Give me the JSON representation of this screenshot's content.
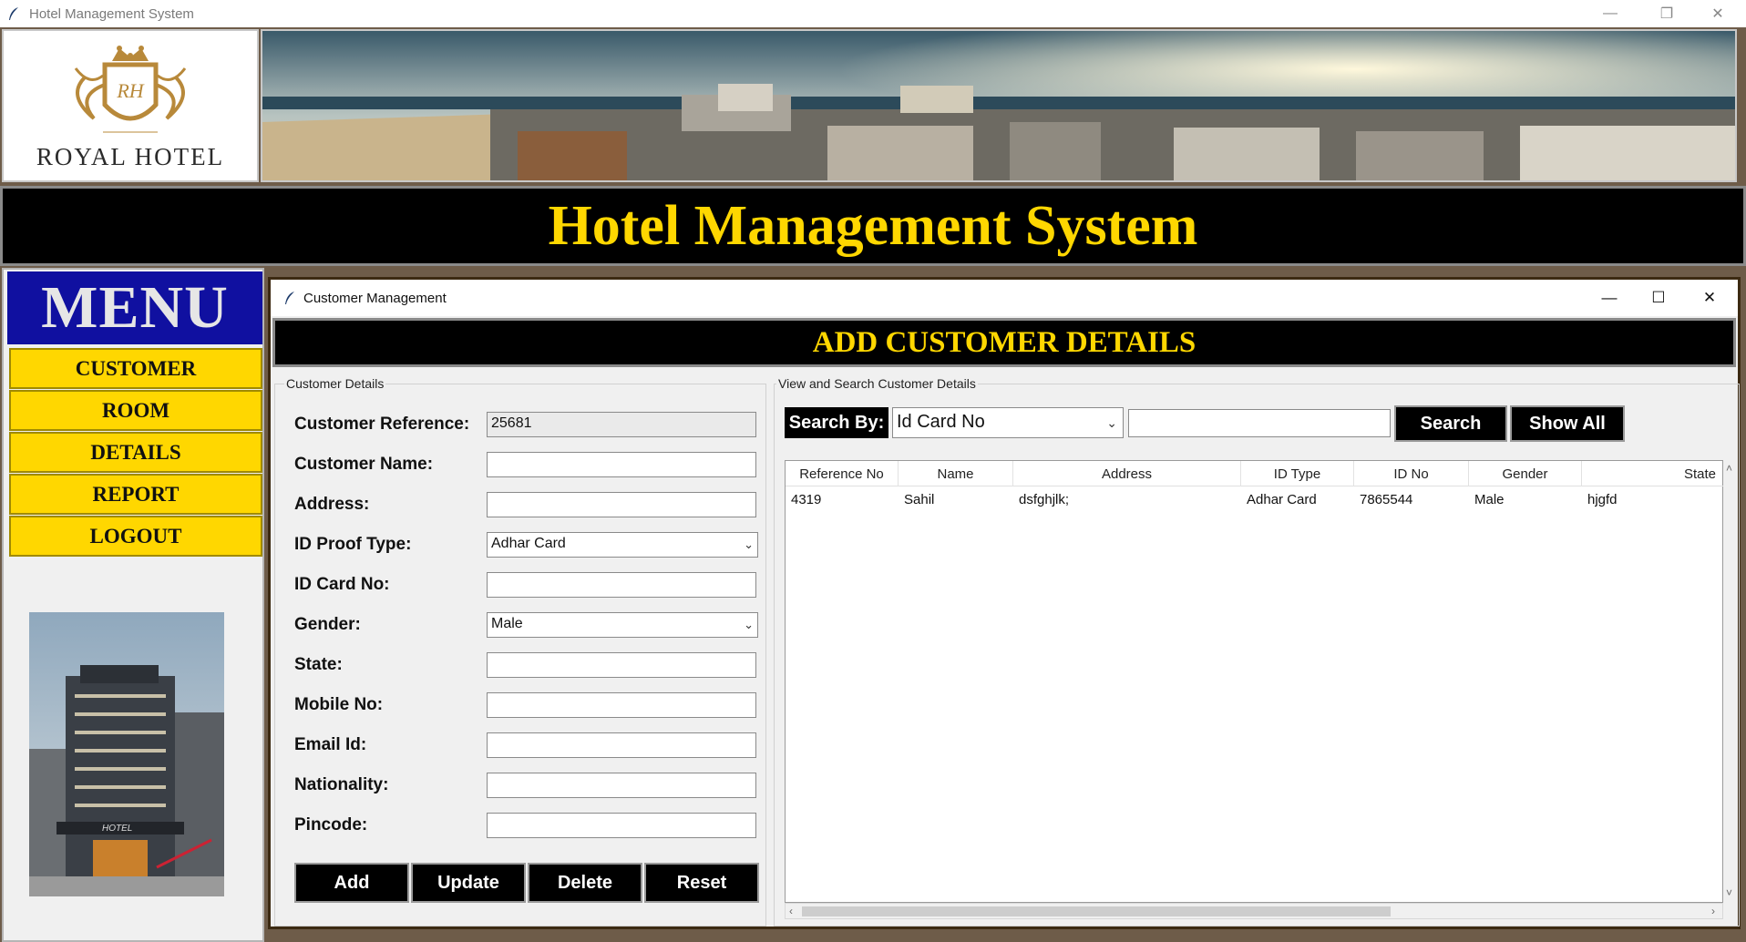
{
  "window": {
    "title": "Hotel Management System",
    "controls": [
      "—",
      "❐",
      "✕"
    ]
  },
  "header": {
    "logo_text": "ROYAL HOTEL",
    "logo_monogram": "RH",
    "banner_title": "Hotel Management System"
  },
  "menu": {
    "title": "MENU",
    "items": [
      {
        "label": "CUSTOMER"
      },
      {
        "label": "ROOM"
      },
      {
        "label": "DETAILS"
      },
      {
        "label": "REPORT"
      },
      {
        "label": "LOGOUT"
      }
    ],
    "image_sign": "HOTEL"
  },
  "child_window": {
    "title": "Customer Management",
    "controls": [
      "—",
      "☐",
      "✕"
    ],
    "heading": "ADD CUSTOMER DETAILS"
  },
  "customer_details": {
    "group_label": "Customer Details",
    "fields": [
      {
        "label": "Customer Reference:",
        "value": "25681"
      },
      {
        "label": "Customer Name:",
        "value": ""
      },
      {
        "label": "Address:",
        "value": ""
      },
      {
        "label": "ID Proof Type:",
        "value": "Adhar Card"
      },
      {
        "label": "ID Card No:",
        "value": ""
      },
      {
        "label": "Gender:",
        "value": "Male"
      },
      {
        "label": "State:",
        "value": ""
      },
      {
        "label": "Mobile No:",
        "value": ""
      },
      {
        "label": "Email Id:",
        "value": ""
      },
      {
        "label": "Nationality:",
        "value": ""
      },
      {
        "label": "Pincode:",
        "value": ""
      }
    ],
    "buttons": {
      "add": "Add",
      "update": "Update",
      "delete": "Delete",
      "reset": "Reset"
    }
  },
  "search_panel": {
    "group_label": "View and Search Customer Details",
    "search_by_label": "Search By:",
    "search_by_value": "Id Card No",
    "search_text": "",
    "search_button": "Search",
    "show_all_button": "Show All",
    "columns": [
      "Reference No",
      "Name",
      "Address",
      "ID Type",
      "ID No",
      "Gender",
      "State"
    ],
    "rows": [
      [
        "4319",
        "Sahil",
        "dsfghjlk;",
        "Adhar Card",
        "7865544",
        "Male",
        "hjgfd"
      ]
    ]
  },
  "colors": {
    "gold": "#ffd700",
    "menu_blue": "#1010a0",
    "black": "#000000"
  }
}
